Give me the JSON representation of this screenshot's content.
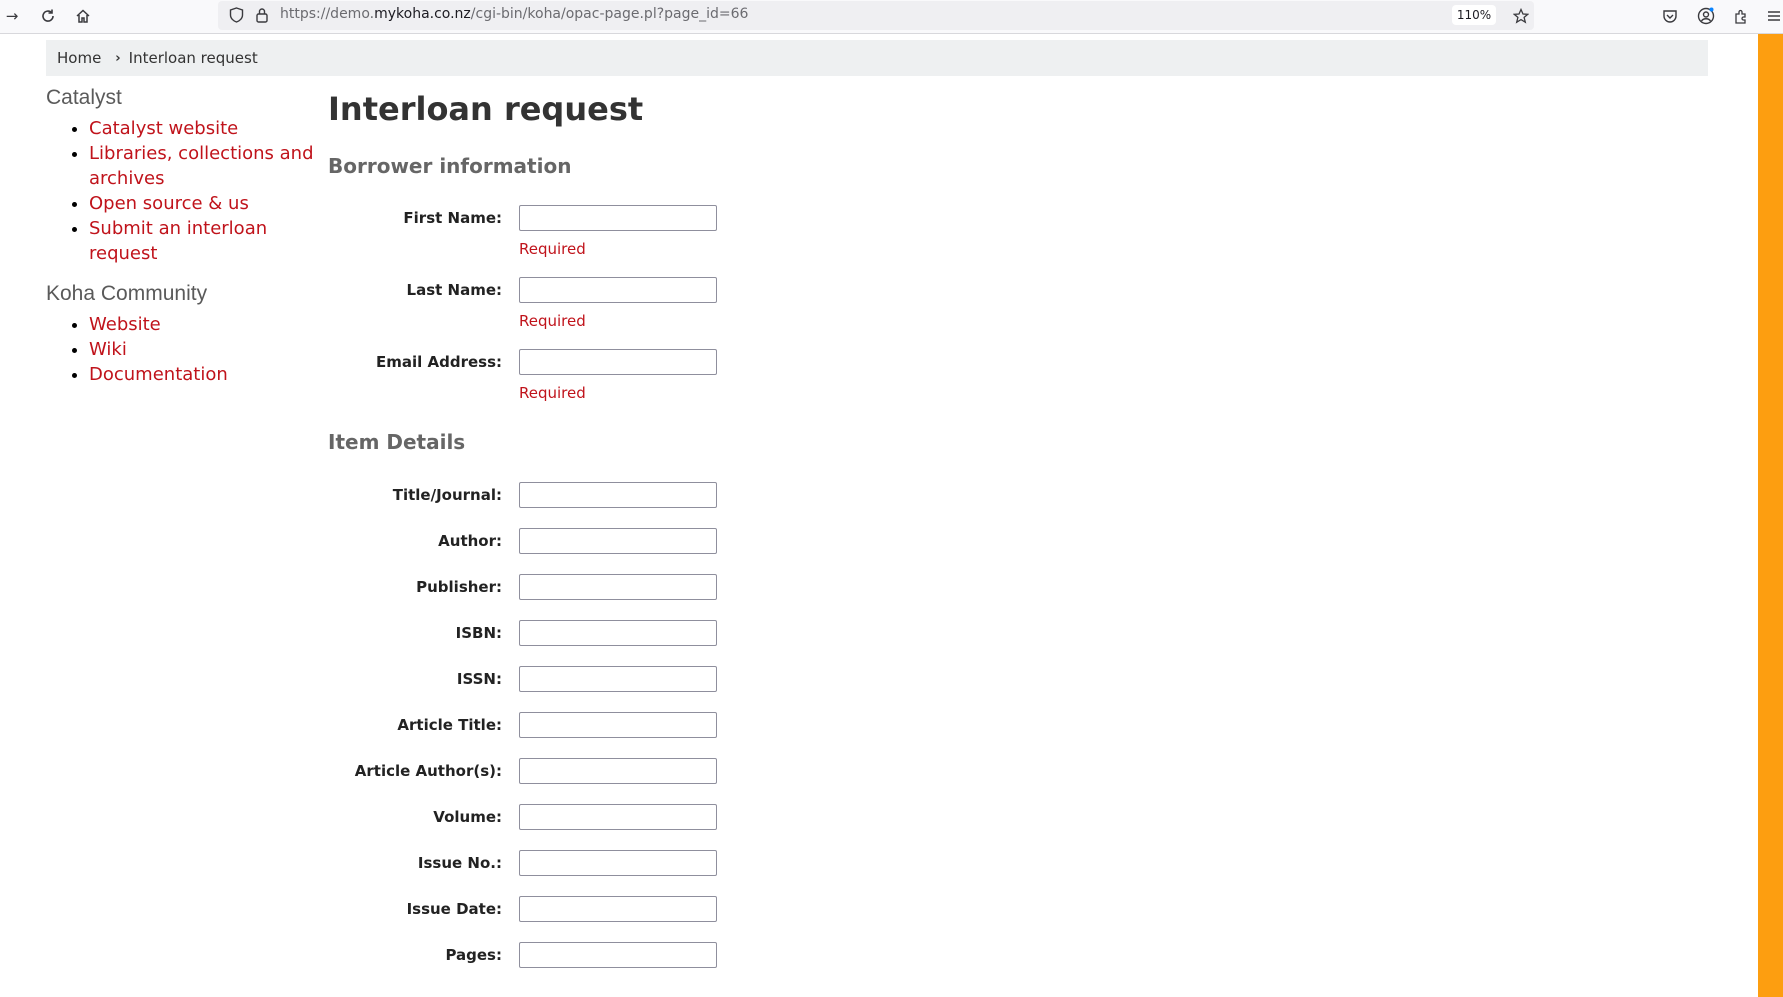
{
  "browser": {
    "url_prefix": "https://demo.",
    "url_host": "mykoha.co.nz",
    "url_path": "/cgi-bin/koha/opac-page.pl?page_id=66",
    "zoom": "110%"
  },
  "breadcrumb": {
    "home": "Home",
    "separator": "›",
    "current": "Interloan request"
  },
  "sidebar": {
    "sections": [
      {
        "title": "Catalyst",
        "links": [
          "Catalyst website",
          "Libraries, collections and archives",
          "Open source & us",
          "Submit an interloan request"
        ]
      },
      {
        "title": "Koha Community",
        "links": [
          "Website",
          "Wiki",
          "Documentation"
        ]
      }
    ]
  },
  "main": {
    "title": "Interloan request",
    "borrower": {
      "heading": "Borrower information",
      "required_text": "Required",
      "fields": [
        "First Name:",
        "Last Name:",
        "Email Address:"
      ]
    },
    "item": {
      "heading": "Item Details",
      "fields": [
        "Title/Journal:",
        "Author:",
        "Publisher:",
        "ISBN:",
        "ISSN:",
        "Article Title:",
        "Article Author(s):",
        "Volume:",
        "Issue No.:",
        "Issue Date:",
        "Pages:"
      ]
    }
  },
  "colors": {
    "link": "#c0131b",
    "accent_strip": "#fd9e10",
    "breadcrumb_bg": "#eef0f1"
  }
}
